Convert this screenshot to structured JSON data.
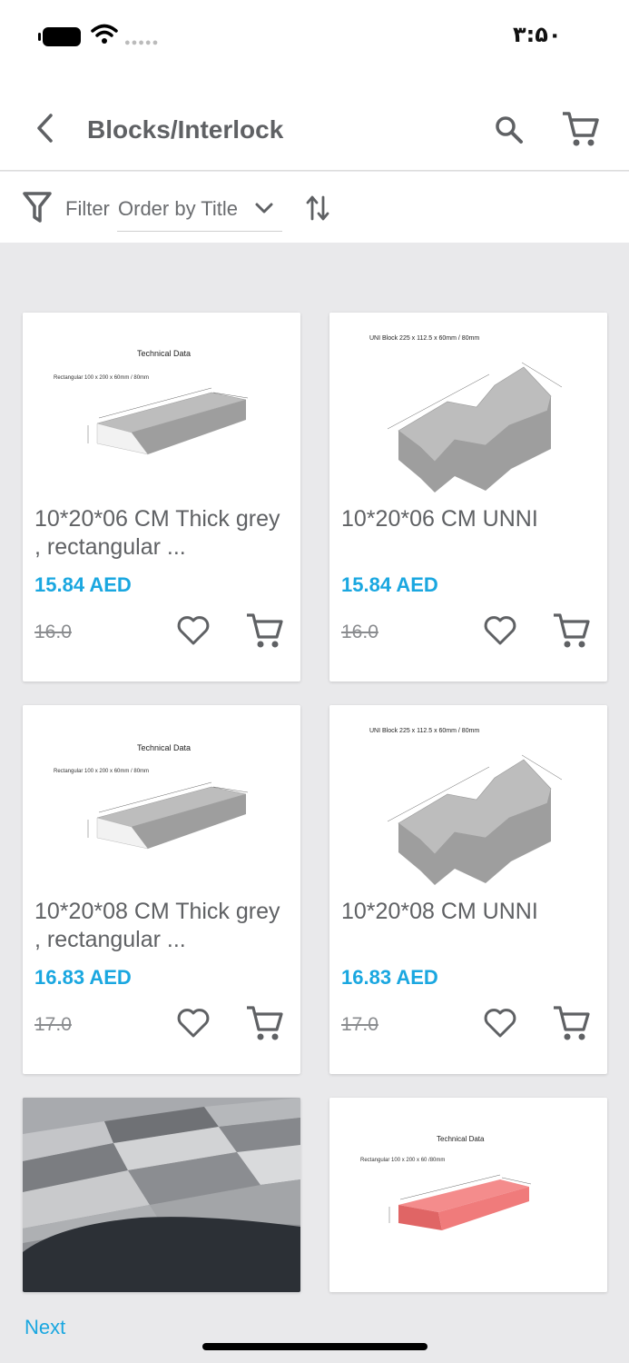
{
  "status": {
    "time": "۳:۵۰",
    "battery_icon": "battery-icon",
    "wifi_icon": "wifi-icon"
  },
  "header": {
    "title": "Blocks/Interlock",
    "back_icon": "chevron-left-icon",
    "search_icon": "search-icon",
    "cart_icon": "cart-icon"
  },
  "filter": {
    "filter_label": "Filter",
    "order_label": "Order by Title",
    "sort_icon": "sort-icon"
  },
  "products": [
    {
      "name": "10*20*06 CM Thick grey , rectangular ...",
      "price": "15.84 AED",
      "old_price": "16.0",
      "image_caption": "Technical Data",
      "image_subcaption": "Rectangular 100 x 200 x 60mm / 80mm"
    },
    {
      "name": "10*20*06 CM UNNI",
      "price": "15.84 AED",
      "old_price": "16.0",
      "image_caption": "UNI Block 225 x 112.5 x 60mm / 80mm"
    },
    {
      "name": "10*20*08 CM Thick grey , rectangular ...",
      "price": "16.83 AED",
      "old_price": "17.0",
      "image_caption": "Technical Data",
      "image_subcaption": "Rectangular 100 x 200 x 60mm / 80mm"
    },
    {
      "name": "10*20*08 CM UNNI",
      "price": "16.83 AED",
      "old_price": "17.0",
      "image_caption": "UNI Block 225 x 112.5 x 60mm / 80mm"
    },
    {
      "image": "paving-photo"
    },
    {
      "image_caption": "Technical Data",
      "image_subcaption": "Rectangular 100 x 200 x 60 /80mm"
    }
  ],
  "pagination": {
    "next_label": "Next"
  },
  "colors": {
    "accent": "#1aa7e0",
    "text": "#5f6164",
    "background": "#e9e9eb",
    "red_block": "#f07b7b"
  }
}
